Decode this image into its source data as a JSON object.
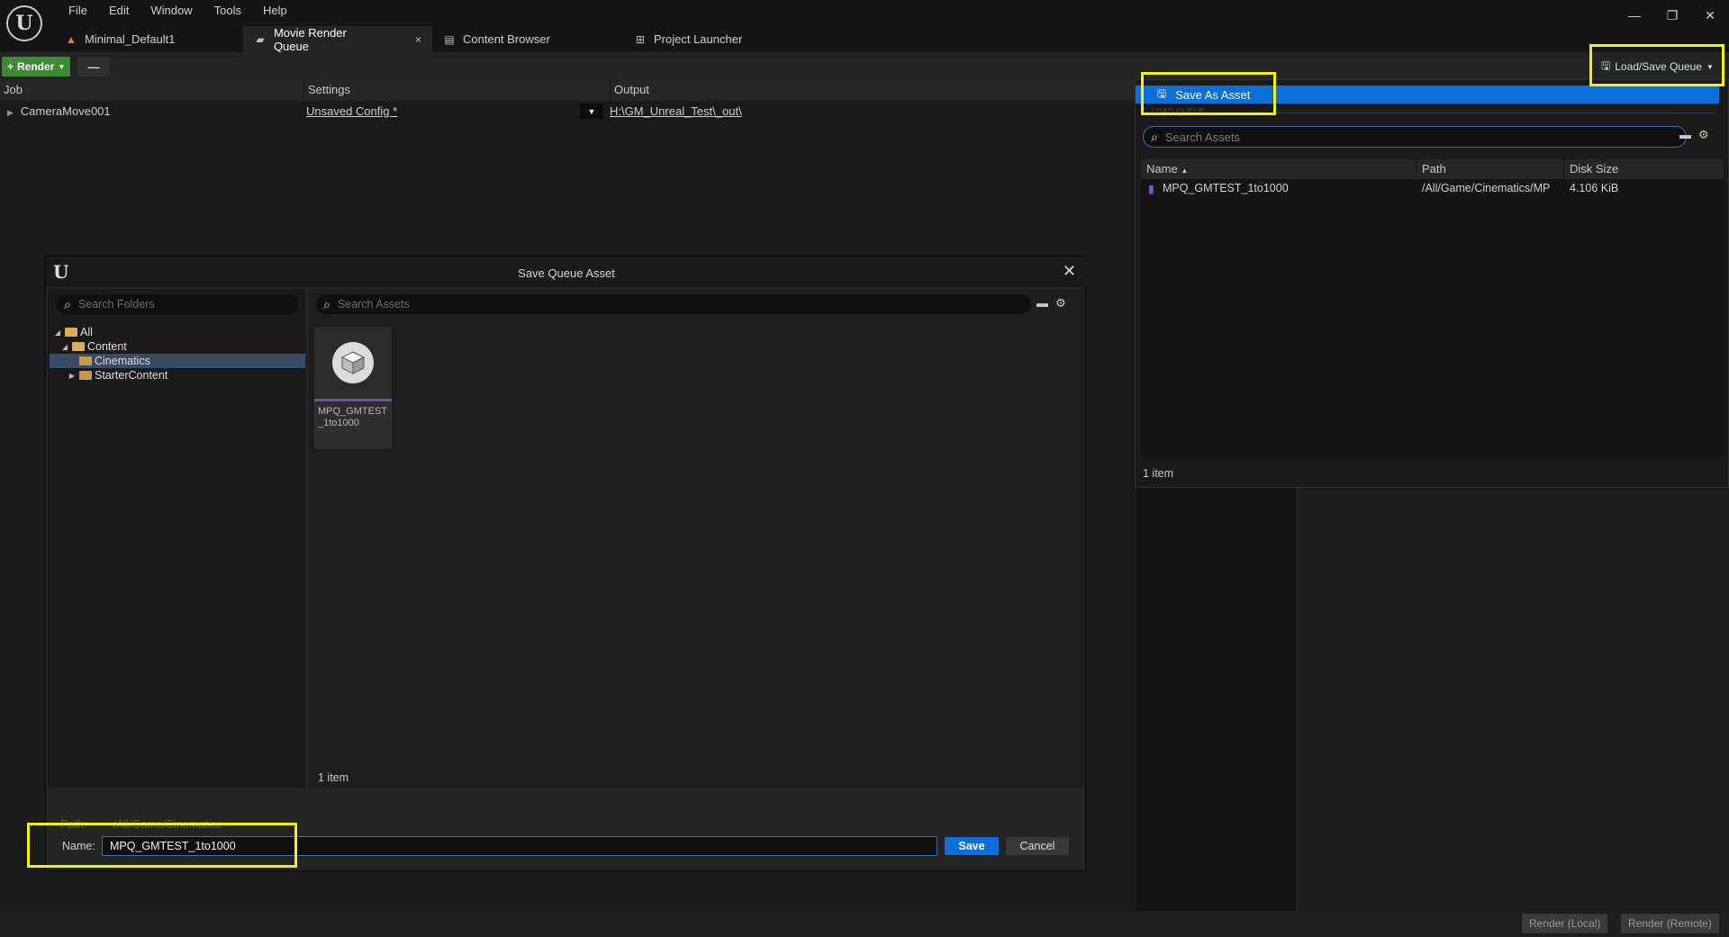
{
  "menu": [
    "File",
    "Edit",
    "Window",
    "Tools",
    "Help"
  ],
  "tabs": [
    {
      "label": "Minimal_Default1",
      "icon": "level-icon"
    },
    {
      "label": "Movie Render Queue",
      "icon": "clapper-icon",
      "active": true
    },
    {
      "label": "Content Browser",
      "icon": "content-browser-icon"
    },
    {
      "label": "Project Launcher",
      "icon": "launcher-icon"
    }
  ],
  "tab_close_glyph": "×",
  "window_controls": [
    "—",
    "❐",
    "✕"
  ],
  "toolbar": {
    "render_label": "Render",
    "minus_label": "—",
    "load_save_label": "Load/Save Queue"
  },
  "jobs": {
    "columns": [
      "Job",
      "Settings",
      "Output"
    ],
    "rows": [
      {
        "job": "CameraMove001",
        "settings": "Unsaved Config *",
        "output": "H:\\GM_Unreal_Test\\_out\\"
      }
    ]
  },
  "popup": {
    "save_as_label": "Save As Asset",
    "faint_label": "LOAD QUEUE",
    "search_placeholder": "Search Assets",
    "columns": [
      "Name",
      "Path",
      "Disk Size"
    ],
    "rows": [
      {
        "name": "MPQ_GMTEST_1to1000",
        "path": "/All/Game/Cinematics/MP",
        "size": "4.106 KiB"
      }
    ],
    "count": "1 item"
  },
  "dialog": {
    "title": "Save Queue Asset",
    "folder_search_placeholder": "Search Folders",
    "tree": [
      {
        "label": "All",
        "level": 0,
        "expanded": true
      },
      {
        "label": "Content",
        "level": 1,
        "expanded": true
      },
      {
        "label": "Cinematics",
        "level": 2,
        "selected": true
      },
      {
        "label": "StarterContent",
        "level": 2,
        "collapsed": true
      }
    ],
    "asset_search_placeholder": "Search Assets",
    "asset_tile_name": "MPQ_GMTEST_1to1000",
    "asset_count": "1 item",
    "path_label": "Path:",
    "path_value": "/All/Game/Cinematics",
    "name_label": "Name:",
    "name_value": "MPQ_GMTEST_1to1000",
    "save_label": "Save",
    "cancel_label": "Cancel"
  },
  "status": {
    "render_local": "Render (Local)",
    "render_remote": "Render (Remote)"
  },
  "colors": {
    "accent_blue": "#0e6fd8",
    "render_green": "#3d8c35",
    "highlight_yellow": "#f2f20a",
    "folder": "#c49a4f"
  }
}
